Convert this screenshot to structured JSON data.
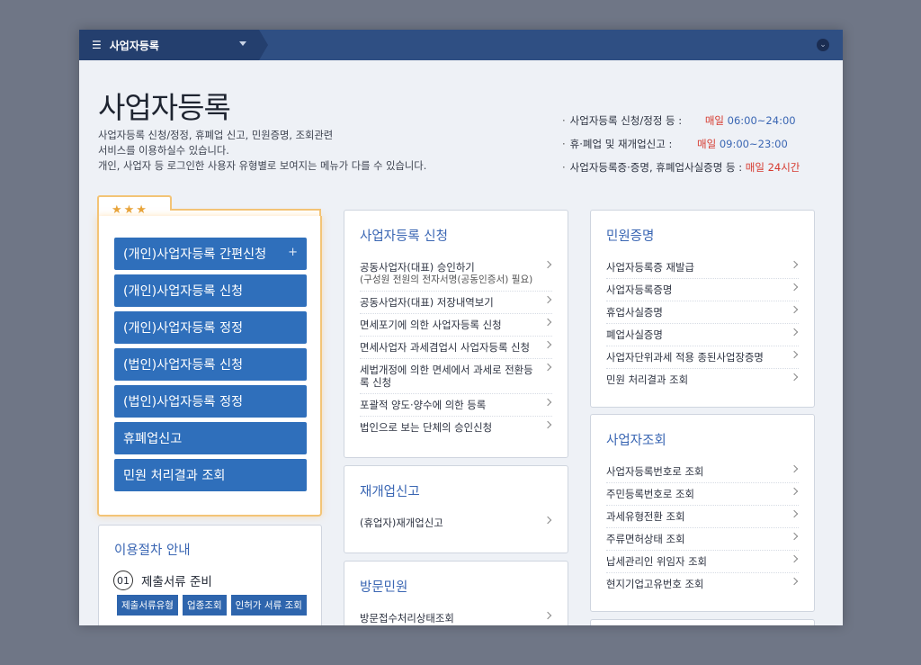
{
  "topbar": {
    "menu_icon": "hamburger-icon",
    "tab_label": "사업자등록",
    "dropdown_icon": "caret-down-icon",
    "toggle_icon": "chevron-down-circle-icon"
  },
  "header": {
    "title": "사업자등록",
    "description": [
      "사업자등록 신청/정정, 휴폐업 신고, 민원증명, 조회관련",
      "서비스를 이용하실수 있습니다.",
      "개인, 사업자 등 로그인한 사용자 유형별로 보여지는 메뉴가 다를 수 있습니다."
    ]
  },
  "service_hours": [
    {
      "label": "사업자등록 신청/정정 등 :",
      "prefix": "매일",
      "time": "06:00~24:00",
      "time_color": "#3a66b3"
    },
    {
      "label": "휴·폐업 및 재개업신고 :",
      "prefix": "매일",
      "time": "09:00~23:00",
      "time_color": "#3a66b3"
    },
    {
      "label": "사업자등록증·증명, 휴폐업사실증명 등 :",
      "prefix": "매일",
      "time": "24시간",
      "time_color": "#d63a2f"
    }
  ],
  "favorites": {
    "stars_icon": "star-icon",
    "stars": "★★★",
    "buttons": [
      {
        "label": "(개인)사업자등록 간편신청",
        "plus": "+"
      },
      {
        "label": "(개인)사업자등록 신청"
      },
      {
        "label": "(개인)사업자등록 정정"
      },
      {
        "label": "(법인)사업자등록 신청"
      },
      {
        "label": "(법인)사업자등록 정정"
      },
      {
        "label": "휴폐업신고"
      },
      {
        "label": "민원 처리결과 조회"
      }
    ]
  },
  "procedure": {
    "title": "이용절차 안내",
    "step_num": "01",
    "step_label": "제출서류 준비",
    "tags": [
      "제출서류유형",
      "업종조회",
      "인허가 서류 조회"
    ]
  },
  "cards": {
    "registration": {
      "title": "사업자등록 신청",
      "items": [
        {
          "label": "공동사업자(대표) 승인하기",
          "sub": "(구성원 전원의 전자서명(공동인증서) 필요)"
        },
        {
          "label": "공동사업자(대표) 저장내역보기"
        },
        {
          "label": "면세포기에 의한 사업자등록 신청"
        },
        {
          "label": "면세사업자 과세겸업시 사업자등록 신청"
        },
        {
          "label": "세법개정에 의한 면세에서 과세로 전환등록 신청"
        },
        {
          "label": "포괄적 양도·양수에 의한 등록"
        },
        {
          "label": "법인으로 보는 단체의 승인신청"
        }
      ]
    },
    "reopen": {
      "title": "재개업신고",
      "items": [
        {
          "label": "(휴업자)재개업신고"
        }
      ]
    },
    "visit": {
      "title": "방문민원",
      "items": [
        {
          "label": "방문접수처리상태조회"
        }
      ]
    },
    "certificate": {
      "title": "민원증명",
      "items": [
        {
          "label": "사업자등록증 재발급"
        },
        {
          "label": "사업자등록증명"
        },
        {
          "label": "휴업사실증명"
        },
        {
          "label": "폐업사실증명"
        },
        {
          "label": "사업자단위과세 적용 종된사업장증명"
        },
        {
          "label": "민원 처리결과 조회"
        }
      ]
    },
    "lookup": {
      "title": "사업자조회",
      "items": [
        {
          "label": "사업자등록번호로 조회"
        },
        {
          "label": "주민등록번호로 조회"
        },
        {
          "label": "과세유형전환 조회"
        },
        {
          "label": "주류면허상태 조회"
        },
        {
          "label": "납세관리인 위임자 조회"
        },
        {
          "label": "현지기업고유번호 조회"
        }
      ]
    }
  }
}
